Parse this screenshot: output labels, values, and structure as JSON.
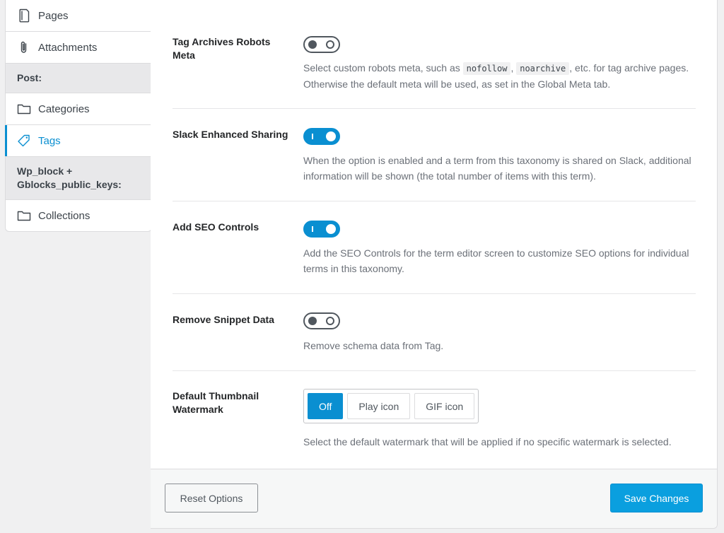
{
  "sidebar": {
    "items": [
      {
        "label": "Pages",
        "icon": "pages-icon"
      },
      {
        "label": "Attachments",
        "icon": "paperclip-icon"
      },
      {
        "group": "Post:"
      },
      {
        "label": "Categories",
        "icon": "folder-icon"
      },
      {
        "label": "Tags",
        "icon": "tag-icon",
        "active": true
      },
      {
        "group": "Wp_block + Gblocks_public_keys:"
      },
      {
        "label": "Collections",
        "icon": "folder-icon"
      }
    ],
    "pages_label": "Pages",
    "attachments_label": "Attachments",
    "post_group": "Post:",
    "categories_label": "Categories",
    "tags_label": "Tags",
    "wpblock_group_line1": "Wp_block +",
    "wpblock_group_line2": "Gblocks_public_keys:",
    "collections_label": "Collections"
  },
  "settings": {
    "robots_meta": {
      "label": "Tag Archives Robots Meta",
      "toggle": "off",
      "desc_before": "Select custom robots meta, such as ",
      "code1": "nofollow",
      "desc_sep": ", ",
      "code2": "noarchive",
      "desc_after": ", etc. for tag archive pages. Otherwise the default meta will be used, as set in the Global Meta tab."
    },
    "slack": {
      "label": "Slack Enhanced Sharing",
      "toggle": "on",
      "desc": "When the option is enabled and a term from this taxonomy is shared on Slack, additional information will be shown (the total number of items with this term)."
    },
    "seo_controls": {
      "label": "Add SEO Controls",
      "toggle": "on",
      "desc": "Add the SEO Controls for the term editor screen to customize SEO options for individual terms in this taxonomy."
    },
    "snippet": {
      "label": "Remove Snippet Data",
      "toggle": "off",
      "desc": "Remove schema data from Tag."
    },
    "watermark": {
      "label": "Default Thumbnail Watermark",
      "options": [
        "Off",
        "Play icon",
        "GIF icon"
      ],
      "selected": "Off",
      "desc": "Select the default watermark that will be applied if no specific watermark is selected."
    }
  },
  "footer": {
    "reset_label": "Reset Options",
    "save_label": "Save Changes"
  },
  "colors": {
    "accent": "#0a8fd1",
    "toggle_off": "#50575e"
  }
}
